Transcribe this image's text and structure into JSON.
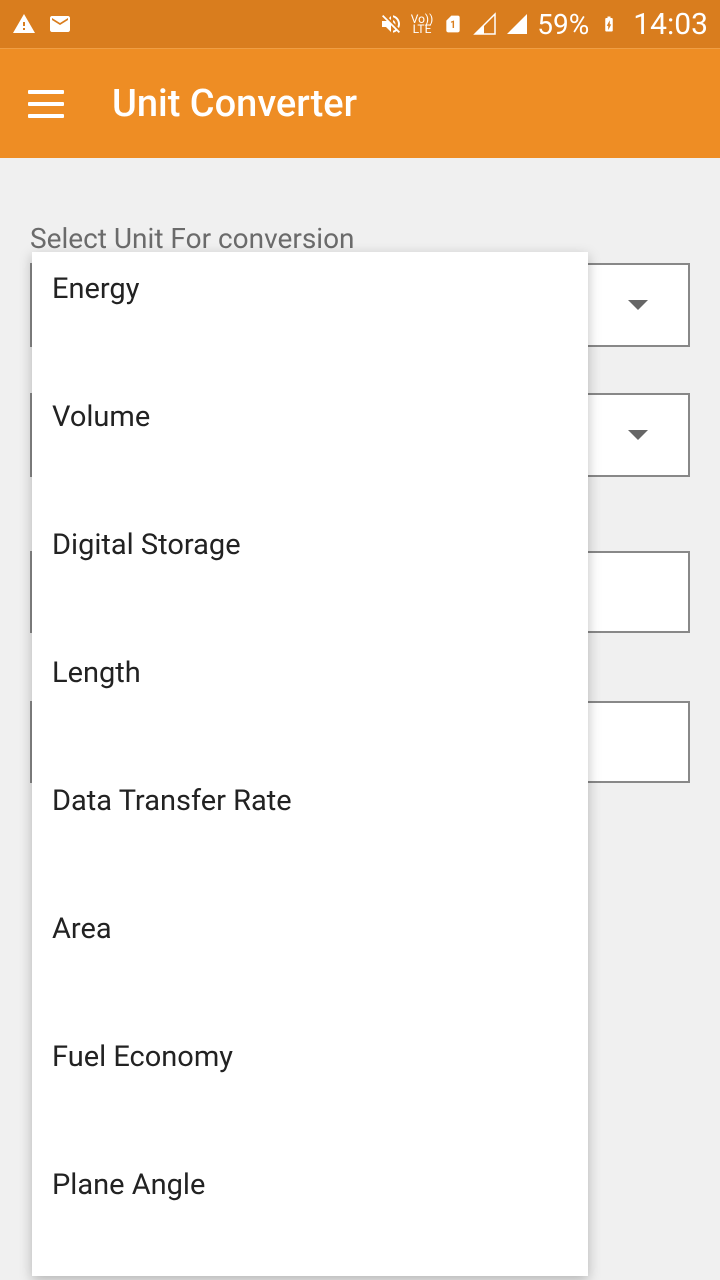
{
  "status_bar": {
    "battery": "59%",
    "time": "14:03",
    "volte": "Vo))\nLTE"
  },
  "app_bar": {
    "title": "Unit Converter"
  },
  "content": {
    "select_label": "Select Unit For conversion"
  },
  "dropdown_options": [
    "Energy",
    "Volume",
    "Digital Storage",
    "Length",
    "Data Transfer Rate",
    "Area",
    "Fuel Economy",
    "Plane Angle"
  ]
}
